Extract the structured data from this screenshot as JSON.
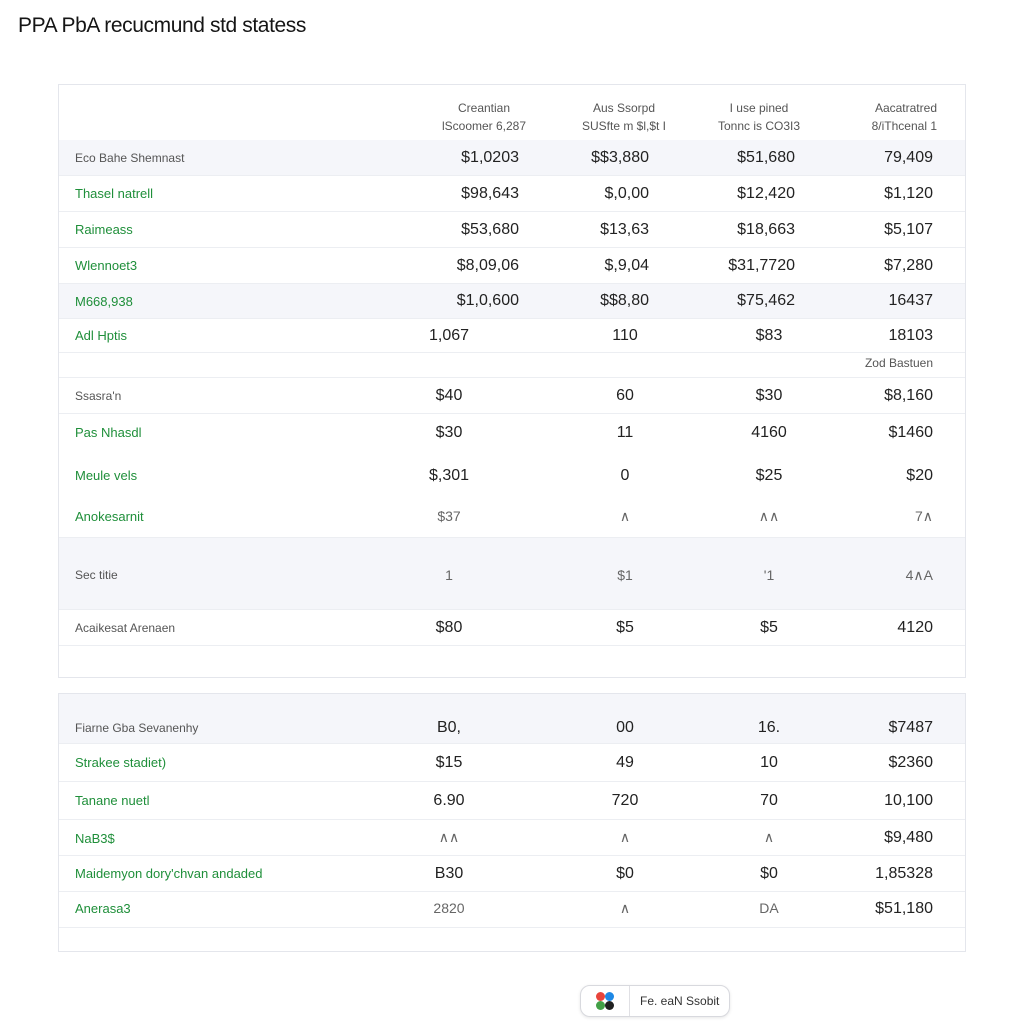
{
  "title": "PPA PbA recucmund std statess",
  "header": {
    "col1": [
      "Creantian",
      "lScoomer 6,287"
    ],
    "col2": [
      "Aus Ssorpd",
      "SUSfte m $l,$t I"
    ],
    "col3": [
      "I use pined",
      "Tonnc is CO3I3"
    ],
    "col4": [
      "Aacatratred",
      "8/iThcenal 1"
    ]
  },
  "section1": [
    {
      "label": "Eco Bahe Shemnast",
      "values": [
        "$1,0203",
        "$$3,880",
        "$51,680",
        "79,409"
      ]
    },
    {
      "label": "Thasel natrell",
      "values": [
        "$98,643",
        "$,0,00",
        "$12,420",
        "$1,120"
      ]
    },
    {
      "label": "Raimeass",
      "values": [
        "$53,680",
        "$13,63",
        "$18,663",
        "$5,107"
      ]
    },
    {
      "label": "Wlennoet3",
      "values": [
        "$8,09,06",
        "$,9,04",
        "$31,7720",
        "$7,280"
      ]
    },
    {
      "label": "M668,938",
      "values": [
        "$1,0,600",
        "$$8,80",
        "$75,462",
        "16437"
      ]
    },
    {
      "label": "Adl Hptis",
      "values": [
        "1,067",
        "110",
        "$83",
        "18103"
      ]
    }
  ],
  "section1_note": "Zod Bastuen",
  "section2": [
    {
      "label": "Ssasra'n",
      "values": [
        "$40",
        "60",
        "$30",
        "$8,160"
      ]
    },
    {
      "label": "Pas Nhasdl",
      "values": [
        "$30",
        "11",
        "4160",
        "$1460"
      ]
    },
    {
      "label": "Meule vels",
      "values": [
        "$,301",
        "0",
        "$25",
        "$20"
      ]
    },
    {
      "label": "Anokesarnit",
      "values": [
        "$37",
        "∧",
        "∧∧",
        "7∧"
      ]
    }
  ],
  "section3": [
    {
      "label": "Sec titie",
      "values": [
        "1",
        "$1",
        "'1",
        "4∧A"
      ]
    },
    {
      "label": "Acaikesat Arenaen",
      "values": [
        "$80",
        "$5",
        "$5",
        "4120"
      ]
    }
  ],
  "section4": [
    {
      "label": "Fiarne Gba Sevanenhy",
      "values": [
        "B0,",
        "00",
        "16.",
        "$7487"
      ]
    },
    {
      "label": "Strakee stadiet)",
      "values": [
        "$15",
        "49",
        "10",
        "$2360"
      ]
    },
    {
      "label": "Tanane nuetl",
      "values": [
        "6.90",
        "720",
        "70",
        "10,100"
      ]
    },
    {
      "label": "NaB3$",
      "values": [
        "∧∧",
        "∧",
        "∧",
        "$9,480"
      ]
    },
    {
      "label": "Maidemyon dory'chvan andaded",
      "values": [
        "B30",
        "$0",
        "$0",
        "1,85328"
      ]
    },
    {
      "label": "Anerasa3",
      "values": [
        "2820",
        "∧",
        "DA",
        "$51,180"
      ]
    }
  ],
  "chip": {
    "label": "Fe. eaN Ssobit"
  },
  "colors": {
    "accent": "#1f8f3a",
    "shade": "#f5f6fa",
    "border": "#e4e6ec"
  }
}
